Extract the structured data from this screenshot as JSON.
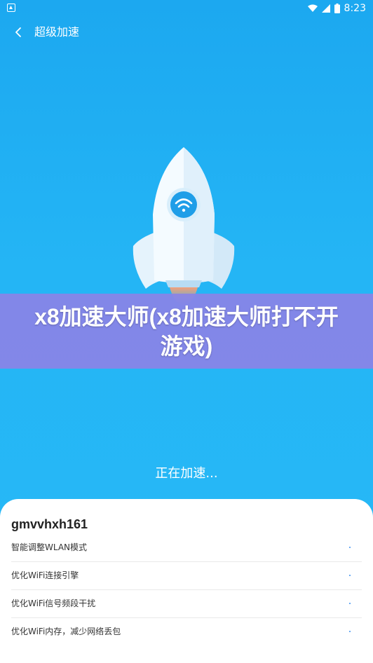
{
  "status_bar": {
    "time": "8:23",
    "left_icon": "notification-icon",
    "right_icons": [
      "wifi-icon",
      "signal-icon",
      "battery-icon"
    ]
  },
  "title_bar": {
    "back_icon": "chevron-left-icon",
    "title": "超级加速"
  },
  "hero": {
    "image": "rocket-wifi-icon"
  },
  "banner": {
    "title": "x8加速大师(x8加速大师打不开游戏)"
  },
  "status": {
    "text": "正在加速..."
  },
  "card": {
    "device_name": "gmvvhxh161",
    "items": [
      {
        "label": "智能调整WLAN模式"
      },
      {
        "label": "优化WiFi连接引擎"
      },
      {
        "label": "优化WiFi信号频段干扰"
      },
      {
        "label": "优化WiFi内存，减少网络丢包"
      }
    ]
  },
  "colors": {
    "background": "#24b5f5",
    "banner": "#8b83e6",
    "card": "#ffffff",
    "accent": "#3b8ff0"
  }
}
